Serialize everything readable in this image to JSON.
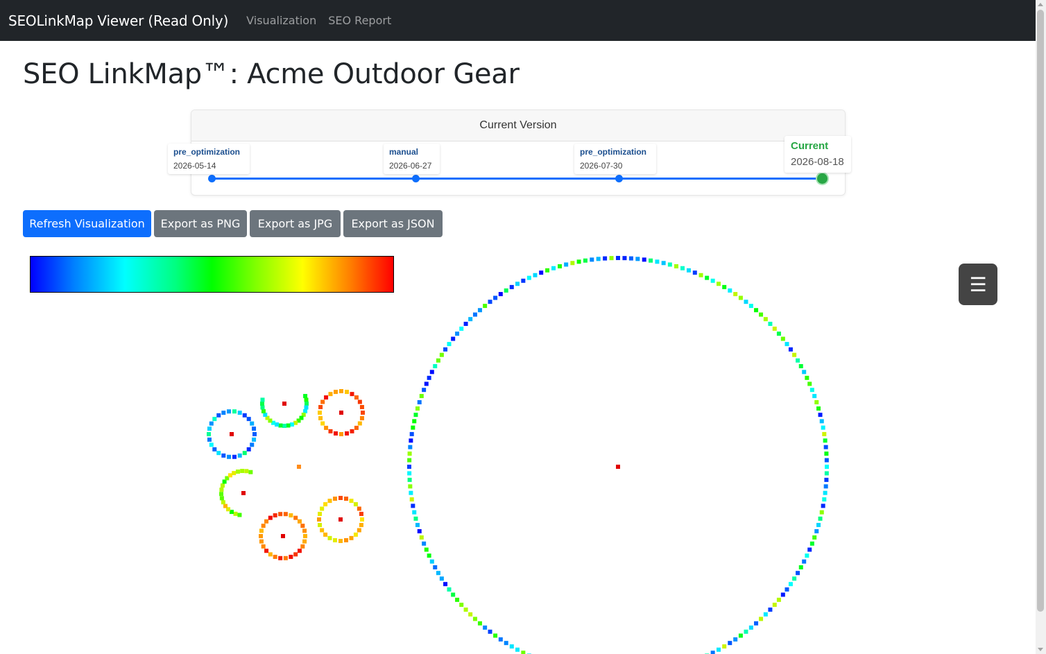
{
  "navbar": {
    "brand": "SEOLinkMap Viewer (Read Only)",
    "links": [
      "Visualization",
      "SEO Report"
    ]
  },
  "page_title": "SEO LinkMap™: Acme Outdoor Gear",
  "version_timeline": {
    "header": "Current Version",
    "versions": [
      {
        "name": "pre_optimization",
        "date": "2026-05-14"
      },
      {
        "name": "manual",
        "date": "2026-06-27"
      },
      {
        "name": "pre_optimization",
        "date": "2026-07-30"
      },
      {
        "name": "Current",
        "date": "2026-08-18",
        "current": true
      }
    ],
    "colors": {
      "track": "#0d6efd",
      "current": "#28a745"
    }
  },
  "toolbar": {
    "refresh_label": "Refresh Visualization",
    "export_png_label": "Export as PNG",
    "export_jpg_label": "Export as JPG",
    "export_json_label": "Export as JSON"
  },
  "menu_button": {
    "icon": "hamburger-menu-icon",
    "glyph": "☰"
  },
  "legend": {
    "type": "color-gradient",
    "colors": [
      "#0000ff",
      "#00ffff",
      "#00ff00",
      "#ffff00",
      "#ff0000"
    ]
  },
  "visualization": {
    "type": "radial-cluster-map",
    "center_color": "#e00000"
  }
}
